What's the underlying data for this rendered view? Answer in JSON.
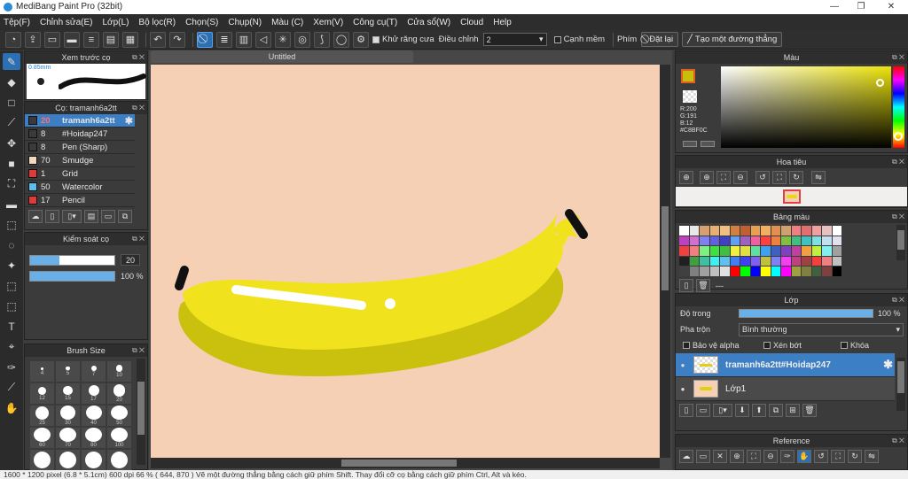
{
  "window": {
    "title": "MediBang Paint Pro (32bit)",
    "minimize": "—",
    "maximize": "❐",
    "close": "✕"
  },
  "menu": [
    "Tệp(F)",
    "Chỉnh sửa(E)",
    "Lớp(L)",
    "Bộ lọc(R)",
    "Chọn(S)",
    "Chụp(N)",
    "Màu (C)",
    "Xem(V)",
    "Công cụ(T)",
    "Cửa sổ(W)",
    "Cloud",
    "Help"
  ],
  "toolbar": {
    "antialias_label": "Khử răng cưa",
    "correction_label": "Điều chỉnh",
    "correction_value": "2",
    "edge_label": "Cạnh mềm",
    "key_label": "Phím",
    "reset_label": "Đặt lại",
    "straight_line_label": "Tạo một đường thẳng"
  },
  "brush_preview": {
    "title": "Xem trước cọ",
    "size": "0.85mm"
  },
  "brush_panel": {
    "title": "Cọ: tramanh6a2tt",
    "items": [
      {
        "size": "20",
        "name": "tramanh6a2tt",
        "color": "#3a3a3a",
        "selected": true
      },
      {
        "size": "8",
        "name": "#Hoidap247",
        "color": "#3a3a3a"
      },
      {
        "size": "8",
        "name": "Pen (Sharp)",
        "color": "#3a3a3a"
      },
      {
        "size": "70",
        "name": "Smudge",
        "color": "#f1d9c0"
      },
      {
        "size": "1",
        "name": "Grid",
        "color": "#e03a3a"
      },
      {
        "size": "50",
        "name": "Watercolor",
        "color": "#5bc0f0"
      },
      {
        "size": "17",
        "name": "Pencil",
        "color": "#e03a3a"
      }
    ]
  },
  "brush_control": {
    "title": "Kiểm soát cọ",
    "size_value": "20",
    "opacity_value": "100 %",
    "size_fraction": 0.35,
    "opacity_fraction": 1.0
  },
  "brush_size": {
    "title": "Brush Size",
    "cells": [
      {
        "label": "4"
      },
      {
        "label": "5"
      },
      {
        "label": "7"
      },
      {
        "label": "10"
      },
      {
        "label": "12"
      },
      {
        "label": "15"
      },
      {
        "label": "17"
      },
      {
        "label": "20"
      },
      {
        "label": "25"
      },
      {
        "label": "30"
      },
      {
        "label": "40"
      },
      {
        "label": "50"
      },
      {
        "label": "60"
      },
      {
        "label": "70"
      },
      {
        "label": "80"
      },
      {
        "label": "100"
      },
      {
        "label": ""
      },
      {
        "label": ""
      },
      {
        "label": ""
      },
      {
        "label": ""
      }
    ]
  },
  "canvas": {
    "tab_title": "Untitled",
    "background": "#f5d0b5"
  },
  "color_panel": {
    "title": "Màu",
    "primary": "#c8bf0c",
    "r": "R:200",
    "g": "G:191",
    "b": "B:12",
    "hex": "#C8BF0C"
  },
  "navigator": {
    "title": "Hoa tiêu"
  },
  "swatches": {
    "title": "Bảng màu",
    "extra": "---",
    "colors": [
      "#ffffff",
      "#e8e8e8",
      "#d8a070",
      "#e8b070",
      "#f0c080",
      "#d08040",
      "#c06030",
      "#e8a050",
      "#f0b060",
      "#e09050",
      "#d0a070",
      "#f08080",
      "#e07070",
      "#f0a0a0",
      "#e8c0c0",
      "#ffffff",
      "#c040c0",
      "#d070d0",
      "#8080f0",
      "#6060e0",
      "#4040c0",
      "#60a0f0",
      "#a060c0",
      "#f060a0",
      "#ff4040",
      "#f08040",
      "#80c040",
      "#40c080",
      "#40c0c0",
      "#80e0e0",
      "#c0e0f0",
      "#e0e0f0",
      "#f04040",
      "#f08080",
      "#80f080",
      "#40e040",
      "#40c040",
      "#f0f040",
      "#e0e040",
      "#60e0a0",
      "#40a0f0",
      "#4060c0",
      "#8040c0",
      "#c040a0",
      "#f0a040",
      "#c0f040",
      "#80f0f0",
      "#a0a0a0",
      "#202020",
      "#40a040",
      "#40c0a0",
      "#40f0f0",
      "#60c0f0",
      "#4080f0",
      "#4040f0",
      "#8060f0",
      "#c0c040",
      "#8080f0",
      "#f040f0",
      "#c04080",
      "#a04040",
      "#f04040",
      "#f08080",
      "#c0c0c0",
      "#404040",
      "#808080",
      "#a0a0a0",
      "#c0c0c0",
      "#e0e0e0",
      "#ff0000",
      "#00ff00",
      "#0000ff",
      "#ffff00",
      "#00ffff",
      "#ff00ff",
      "#a0a040",
      "#808040",
      "#406040",
      "#804040",
      "#000000"
    ]
  },
  "layer_panel": {
    "title": "Lớp",
    "opacity_label": "Độ trong",
    "opacity_value": "100 %",
    "blend_label": "Pha trộn",
    "blend_value": "Bình thường",
    "protect_alpha": "Bảo vệ alpha",
    "clipping": "Xén bớt",
    "lock": "Khóa",
    "layers": [
      {
        "name": "tramanh6a2tt#Hoidap247",
        "selected": true
      },
      {
        "name": "Lớp1",
        "selected": false
      }
    ]
  },
  "reference": {
    "title": "Reference"
  },
  "status": {
    "text": "1600 * 1200 pixel   (6.8 * 5.1cm)   600 dpi   66 %   ( 644, 870 )   Vẽ một đường thẳng bằng cách giữ phím Shift. Thay đổi cỡ cọ bằng cách giữ phím Ctrl, Alt và kéo."
  }
}
